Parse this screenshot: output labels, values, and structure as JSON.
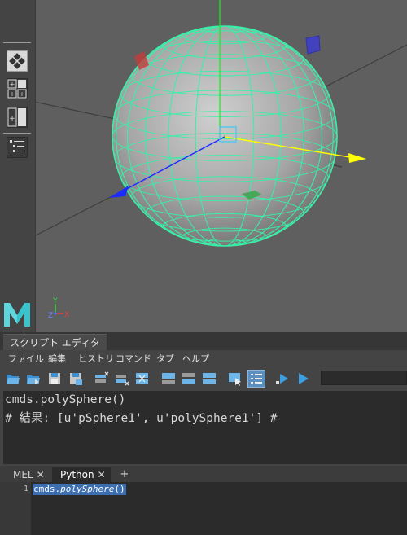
{
  "script_editor": {
    "title": "スクリプト エディタ",
    "menu": [
      "ファイル",
      "編集",
      "ヒストリ",
      "コマンド",
      "タブ",
      "ヘルプ"
    ],
    "history": {
      "line1": "cmds.polySphere()",
      "line2": "# 結果: [u'pSphere1', u'polySphere1'] #"
    },
    "tabs": [
      {
        "label": "MEL",
        "active": false
      },
      {
        "label": "Python",
        "active": true
      },
      {
        "label": "+"
      }
    ],
    "close_glyph": "✕",
    "input": {
      "line_number": "1",
      "code_prefix": "cmds.",
      "code_func": "polySphere",
      "code_suffix": "()"
    }
  },
  "viewport": {
    "axis_labels": {
      "y": "Y",
      "z": "Z",
      "x": "X"
    },
    "logo_name": "maya-logo"
  },
  "colors": {
    "viewport_bg": "#5f5f5f",
    "wireframe": "#38f0a8",
    "x_axis": "#ffff00",
    "y_axis": "#00ff00",
    "z_axis": "#1a2cff",
    "selection": "#3d6fb0"
  }
}
